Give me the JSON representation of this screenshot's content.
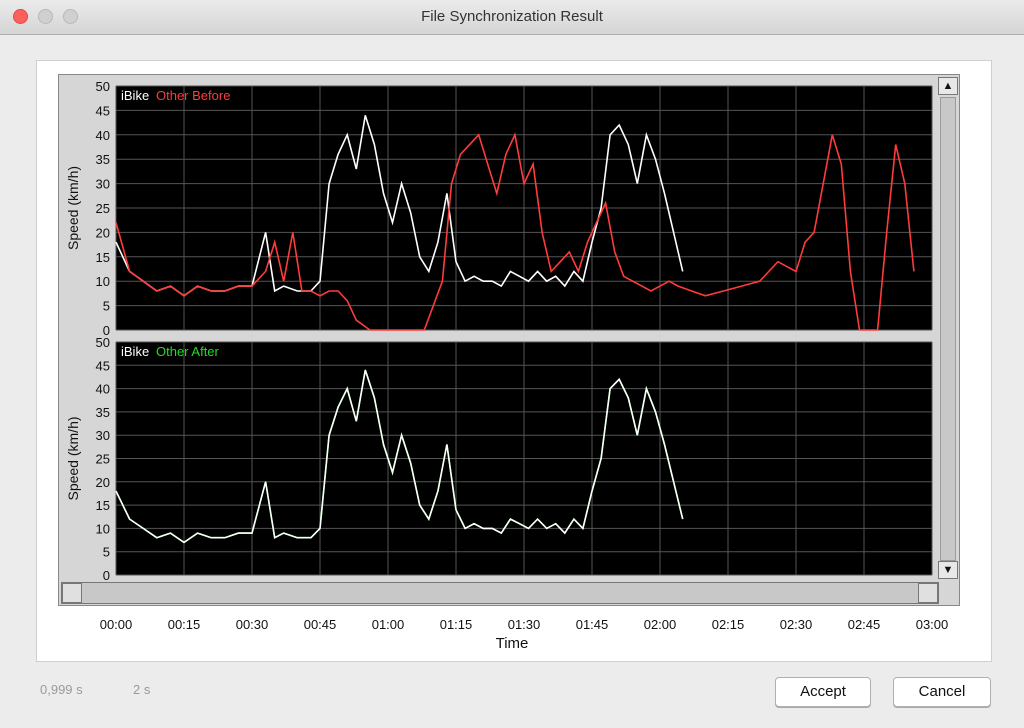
{
  "window": {
    "title": "File Synchronization Result"
  },
  "status": {
    "left_value": "0,999 s",
    "right_value": "2 s"
  },
  "buttons": {
    "accept": "Accept",
    "cancel": "Cancel"
  },
  "colors": {
    "ibike": "#ffffff",
    "before": "#ff3b3b",
    "after": "#22dd22",
    "plot_bg": "#000000",
    "grid": "#555555"
  },
  "chart_data": [
    {
      "type": "line",
      "legend": [
        "iBike",
        "Other Before"
      ],
      "ylabel": "Speed (km/h)",
      "ylim": [
        0,
        50
      ],
      "yticks": [
        0,
        5,
        10,
        15,
        20,
        25,
        30,
        35,
        40,
        45,
        50
      ],
      "x_unit": "minutes",
      "xlim": [
        0,
        180
      ],
      "series": [
        {
          "name": "iBike",
          "x": [
            0,
            3,
            6,
            9,
            12,
            15,
            18,
            21,
            24,
            27,
            30,
            33,
            35,
            37,
            40,
            43,
            45,
            47,
            49,
            51,
            53,
            55,
            57,
            59,
            61,
            63,
            65,
            67,
            69,
            71,
            73,
            75,
            77,
            79,
            81,
            83,
            85,
            87,
            89,
            91,
            93,
            95,
            97,
            99,
            101,
            103,
            105,
            107,
            109,
            111,
            113,
            115,
            117,
            119,
            121,
            123,
            125
          ],
          "y": [
            18,
            12,
            10,
            8,
            9,
            7,
            9,
            8,
            8,
            9,
            9,
            20,
            8,
            9,
            8,
            8,
            10,
            30,
            36,
            40,
            33,
            44,
            38,
            28,
            22,
            30,
            24,
            15,
            12,
            18,
            28,
            14,
            10,
            11,
            10,
            10,
            9,
            12,
            11,
            10,
            12,
            10,
            11,
            9,
            12,
            10,
            18,
            25,
            40,
            42,
            38,
            30,
            40,
            35,
            28,
            20,
            12
          ]
        },
        {
          "name": "Other Before",
          "x": [
            0,
            3,
            6,
            9,
            12,
            15,
            18,
            21,
            24,
            27,
            30,
            33,
            35,
            37,
            39,
            41,
            43,
            45,
            47,
            49,
            51,
            53,
            56,
            60,
            64,
            68,
            72,
            74,
            76,
            78,
            80,
            82,
            84,
            86,
            88,
            90,
            92,
            94,
            96,
            98,
            100,
            102,
            104,
            106,
            108,
            110,
            112,
            114,
            116,
            118,
            120,
            122,
            124,
            127,
            130,
            134,
            138,
            142,
            146,
            150,
            152,
            154,
            156,
            158,
            160,
            162,
            164,
            166,
            168,
            170,
            172,
            174,
            176
          ],
          "y": [
            22,
            12,
            10,
            8,
            9,
            7,
            9,
            8,
            8,
            9,
            9,
            12,
            18,
            10,
            20,
            8,
            8,
            7,
            8,
            8,
            6,
            2,
            0,
            0,
            0,
            0,
            10,
            30,
            36,
            38,
            40,
            34,
            28,
            36,
            40,
            30,
            34,
            20,
            12,
            14,
            16,
            12,
            18,
            22,
            26,
            16,
            11,
            10,
            9,
            8,
            9,
            10,
            9,
            8,
            7,
            8,
            9,
            10,
            14,
            12,
            18,
            20,
            30,
            40,
            34,
            12,
            0,
            0,
            0,
            20,
            38,
            30,
            12
          ]
        }
      ]
    },
    {
      "type": "line",
      "legend": [
        "iBike",
        "Other After"
      ],
      "ylabel": "Speed (km/h)",
      "xlabel": "Time",
      "ylim": [
        0,
        50
      ],
      "yticks": [
        0,
        5,
        10,
        15,
        20,
        25,
        30,
        35,
        40,
        45,
        50
      ],
      "x_unit": "minutes",
      "xlim": [
        0,
        180
      ],
      "xticks": [
        "00:00",
        "00:15",
        "00:30",
        "00:45",
        "01:00",
        "01:15",
        "01:30",
        "01:45",
        "02:00",
        "02:15",
        "02:30",
        "02:45",
        "03:00"
      ],
      "series": [
        {
          "name": "Other After",
          "x": [
            0,
            3,
            6,
            9,
            12,
            15,
            18,
            21,
            24,
            27,
            30,
            33,
            35,
            37,
            40,
            43,
            45,
            47,
            49,
            51,
            53,
            55,
            57,
            59,
            61,
            63,
            65,
            67,
            69,
            71,
            73,
            75,
            77,
            79,
            81,
            83,
            85,
            87,
            89,
            91,
            93,
            95,
            97,
            99,
            101,
            103,
            105,
            107,
            109,
            111,
            113,
            115,
            117,
            119,
            121,
            123,
            125
          ],
          "y": [
            18,
            12,
            10,
            8,
            9,
            7,
            9,
            8,
            8,
            9,
            9,
            20,
            8,
            9,
            8,
            8,
            10,
            30,
            36,
            40,
            33,
            44,
            38,
            28,
            22,
            30,
            24,
            15,
            12,
            18,
            28,
            14,
            10,
            11,
            10,
            10,
            9,
            12,
            11,
            10,
            12,
            10,
            11,
            9,
            12,
            10,
            18,
            25,
            40,
            42,
            38,
            30,
            40,
            35,
            28,
            20,
            12
          ]
        },
        {
          "name": "iBike",
          "x": [
            0,
            3,
            6,
            9,
            12,
            15,
            18,
            21,
            24,
            27,
            30,
            33,
            35,
            37,
            40,
            43,
            45,
            47,
            49,
            51,
            53,
            55,
            57,
            59,
            61,
            63,
            65,
            67,
            69,
            71,
            73,
            75,
            77,
            79,
            81,
            83,
            85,
            87,
            89,
            91,
            93,
            95,
            97,
            99,
            101,
            103,
            105,
            107,
            109,
            111,
            113,
            115,
            117,
            119,
            121,
            123,
            125
          ],
          "y": [
            18,
            12,
            10,
            8,
            9,
            7,
            9,
            8,
            8,
            9,
            9,
            20,
            8,
            9,
            8,
            8,
            10,
            30,
            36,
            40,
            33,
            44,
            38,
            28,
            22,
            30,
            24,
            15,
            12,
            18,
            28,
            14,
            10,
            11,
            10,
            10,
            9,
            12,
            11,
            10,
            12,
            10,
            11,
            9,
            12,
            10,
            18,
            25,
            40,
            42,
            38,
            30,
            40,
            35,
            28,
            20,
            12
          ]
        }
      ]
    }
  ]
}
